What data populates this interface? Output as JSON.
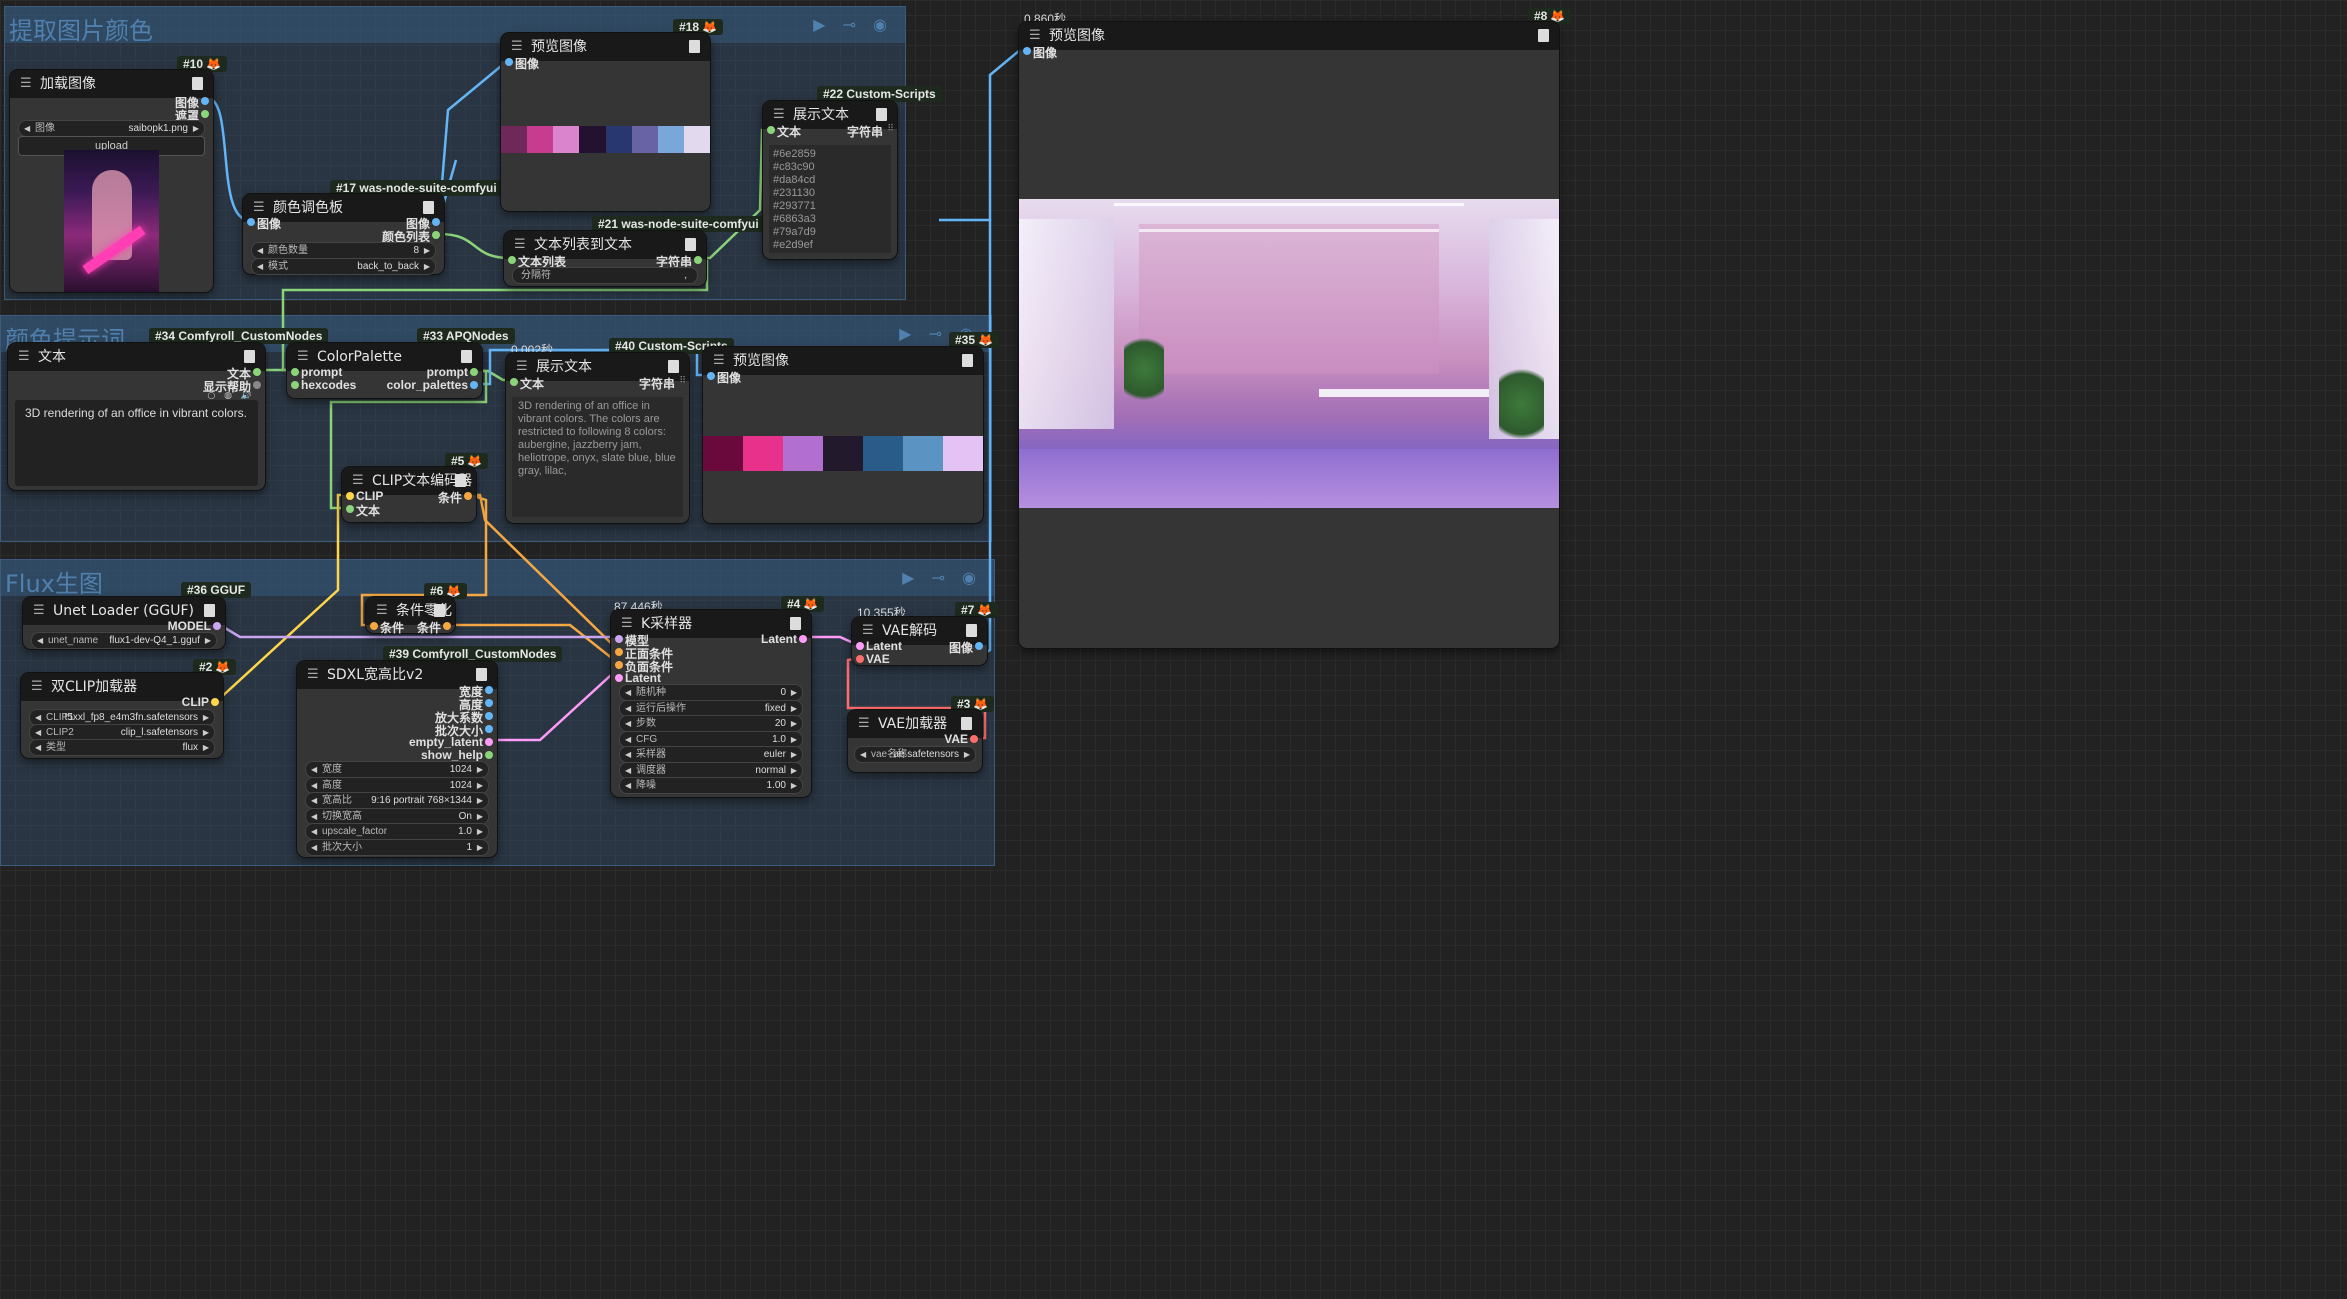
{
  "groups": {
    "g1": "提取图片颜色",
    "g2": "颜色提示词",
    "g3": "Flux生图"
  },
  "group_icons": "▶ ⊸ ◉",
  "colors": {
    "palette_top": [
      "#6e2859",
      "#c83c90",
      "#da84cd",
      "#231130",
      "#293771",
      "#6863a3",
      "#79a7d9",
      "#e2d9ef"
    ],
    "palette_mid": [
      "#6a0a3c",
      "#e8318a",
      "#b26fcf",
      "#221a2c",
      "#2a5c8a",
      "#5b93c3",
      "#e4c3f4"
    ],
    "wire_image": "#64b5f6",
    "wire_string": "#8bd47a",
    "wire_cond": "#f5a742",
    "wire_clip": "#ffd54a",
    "wire_model": "#c9a6ef",
    "wire_latent": "#ff9cf9",
    "wire_vae": "#ff6e6e"
  },
  "n10": {
    "badge": "#10",
    "title": "加载图像",
    "out1": "图像",
    "out2": "遮罩",
    "w_label": "图像",
    "w_value": "saibopk1.png",
    "upload": "upload"
  },
  "n17": {
    "badge": "#17 was-node-suite-comfyui",
    "title": "颜色调色板",
    "in1": "图像",
    "out1": "图像",
    "out2": "颜色列表",
    "w1_label": "颜色数量",
    "w1_value": "8",
    "w2_label": "模式",
    "w2_value": "back_to_back"
  },
  "n18": {
    "badge": "#18",
    "title": "预览图像",
    "in1": "图像"
  },
  "n21": {
    "badge": "#21 was-node-suite-comfyui",
    "title": "文本列表到文本",
    "in1": "文本列表",
    "out1": "字符串",
    "w_label": "分隔符",
    "w_value": ","
  },
  "n22": {
    "badge": "#22 Custom-Scripts",
    "title": "展示文本",
    "in1": "文本",
    "out1": "字符串",
    "text": "#6e2859\n#c83c90\n#da84cd\n#231130\n#293771\n#6863a3\n#79a7d9\n#e2d9ef"
  },
  "n8": {
    "timing": "0.860秒",
    "badge": "#8",
    "title": "预览图像",
    "in1": "图像"
  },
  "n34": {
    "badge": "#34 Comfyroll_CustomNodes",
    "title": "文本",
    "out1": "文本",
    "out2": "显示帮助",
    "text": "3D rendering of an office in vibrant colors."
  },
  "n33": {
    "badge": "#33 APQNodes",
    "title": "ColorPalette",
    "in1": "prompt",
    "in2": "hexcodes",
    "out1": "prompt",
    "out2": "color_palettes"
  },
  "n40": {
    "timing": "0.002秒",
    "badge": "#40 Custom-Scripts",
    "title": "展示文本",
    "in1": "文本",
    "out1": "字符串",
    "text": "3D rendering of an office in vibrant colors. The colors are restricted to following 8 colors: aubergine, jazzberry jam, heliotrope, onyx, slate blue, blue gray, lilac,"
  },
  "n35": {
    "badge": "#35",
    "title": "预览图像",
    "in1": "图像"
  },
  "n5": {
    "badge": "#5",
    "title": "CLIP文本编码器",
    "in1": "CLIP",
    "in2": "文本",
    "out1": "条件"
  },
  "n36": {
    "badge": "#36 GGUF",
    "title": "Unet Loader (GGUF)",
    "out1": "MODEL",
    "w_label": "unet_name",
    "w_value": "flux1-dev-Q4_1.gguf"
  },
  "n6": {
    "badge": "#6",
    "title": "条件零化",
    "in1": "条件",
    "out1": "条件"
  },
  "n2": {
    "badge": "#2",
    "title": "双CLIP加载器",
    "out1": "CLIP",
    "w1_label": "CLIP1",
    "w1_value": "t5xxl_fp8_e4m3fn.safetensors",
    "w2_label": "CLIP2",
    "w2_value": "clip_l.safetensors",
    "w3_label": "类型",
    "w3_value": "flux"
  },
  "n39": {
    "badge": "#39 Comfyroll_CustomNodes",
    "title": "SDXL宽高比v2",
    "outs": [
      "宽度",
      "高度",
      "放大系数",
      "批次大小",
      "empty_latent",
      "show_help"
    ],
    "widgets": [
      {
        "label": "宽度",
        "value": "1024"
      },
      {
        "label": "高度",
        "value": "1024"
      },
      {
        "label": "宽高比",
        "value": "9:16 portrait 768×1344"
      },
      {
        "label": "切换宽高",
        "value": "On"
      },
      {
        "label": "upscale_factor",
        "value": "1.0"
      },
      {
        "label": "批次大小",
        "value": "1"
      }
    ]
  },
  "n4": {
    "timing": "87.446秒",
    "badge": "#4",
    "title": "K采样器",
    "ins": [
      "模型",
      "正面条件",
      "负面条件",
      "Latent"
    ],
    "out1": "Latent",
    "widgets": [
      {
        "label": "随机种",
        "value": "0"
      },
      {
        "label": "运行后操作",
        "value": "fixed"
      },
      {
        "label": "步数",
        "value": "20"
      },
      {
        "label": "CFG",
        "value": "1.0"
      },
      {
        "label": "采样器",
        "value": "euler"
      },
      {
        "label": "调度器",
        "value": "normal"
      },
      {
        "label": "降噪",
        "value": "1.00"
      }
    ]
  },
  "n7": {
    "timing": "10.355秒",
    "badge": "#7",
    "title": "VAE解码",
    "in1": "Latent",
    "in2": "VAE",
    "out1": "图像"
  },
  "n3": {
    "badge": "#3",
    "title": "VAE加载器",
    "out1": "VAE",
    "w_label": "vae名称",
    "w_value": "ae.safetensors"
  }
}
